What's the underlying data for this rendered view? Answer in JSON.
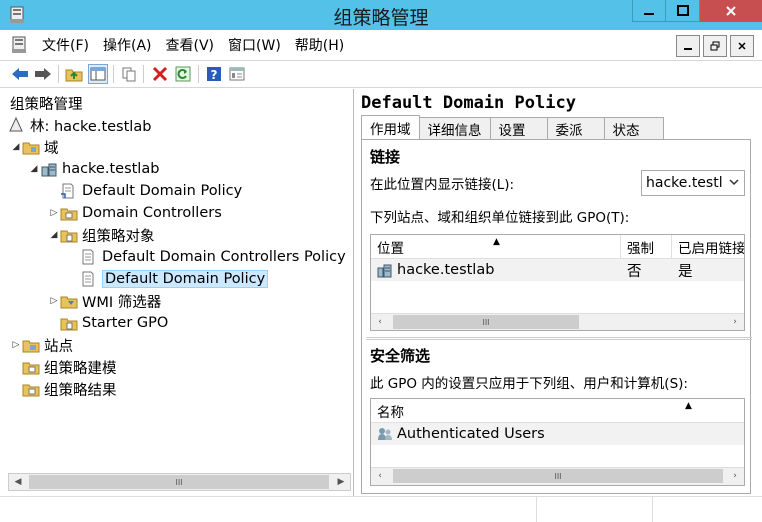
{
  "window": {
    "title": "组策略管理",
    "accent": "#53c1e8",
    "close_color": "#c74f4f"
  },
  "menu": {
    "items": [
      "文件(F)",
      "操作(A)",
      "查看(V)",
      "窗口(W)",
      "帮助(H)"
    ]
  },
  "toolbar": {
    "icons": [
      "back-arrow-icon",
      "forward-arrow-icon",
      "up-folder-icon",
      "show-hide-tree-icon",
      "copy-icon",
      "delete-icon",
      "refresh-icon",
      "help-icon",
      "properties-icon"
    ]
  },
  "tree": {
    "root": "组策略管理",
    "forest": "林: hacke.testlab",
    "domains": "域",
    "domain": "hacke.testlab",
    "default_policy_link": "Default Domain Policy",
    "domain_controllers": "Domain Controllers",
    "gpo_container": "组策略对象",
    "gpo_dc_policy": "Default Domain Controllers Policy",
    "gpo_domain_policy": "Default Domain Policy",
    "wmi_filters": "WMI 筛选器",
    "starter_gpo": "Starter GPO",
    "sites": "站点",
    "modeling": "组策略建模",
    "results": "组策略结果"
  },
  "detail": {
    "policy_title": "Default Domain Policy",
    "tabs": [
      "作用域",
      "详细信息",
      "设置",
      "委派",
      "状态"
    ],
    "links": {
      "heading": "链接",
      "show_links_label": "在此位置内显示链接(L):",
      "location_value": "hacke.testl",
      "description": "下列站点、域和组织单位链接到此 GPO(T):",
      "columns": [
        "位置",
        "强制",
        "已启用链接"
      ],
      "rows": [
        {
          "location": "hacke.testlab",
          "enforced": "否",
          "enabled": "是"
        }
      ]
    },
    "security": {
      "heading": "安全筛选",
      "description": "此 GPO 内的设置只应用于下列组、用户和计算机(S):",
      "columns": [
        "名称"
      ],
      "rows": [
        {
          "name": "Authenticated Users"
        }
      ]
    }
  },
  "scrollbar": {
    "grip": "III"
  }
}
